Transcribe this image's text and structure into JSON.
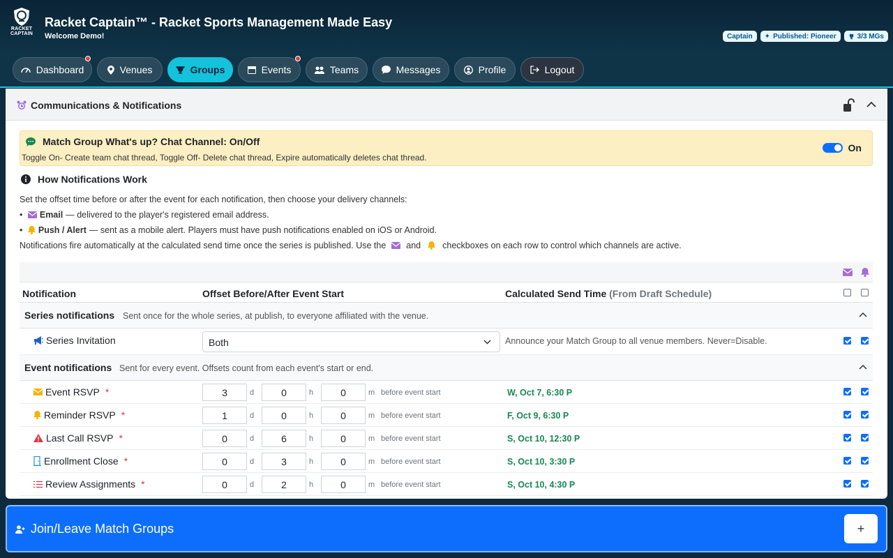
{
  "header": {
    "logo_text_1": "RACKET",
    "logo_text_2": "CAPTAIN",
    "title": "Racket Captain™ - Racket Sports Management Made Easy",
    "welcome": "Welcome Demo!",
    "badges": {
      "role": "Captain",
      "published": "Published: Pioneer",
      "mgs": "3/3 MGs"
    }
  },
  "nav": {
    "dashboard": "Dashboard",
    "venues": "Venues",
    "groups": "Groups",
    "events": "Events",
    "teams": "Teams",
    "messages": "Messages",
    "profile": "Profile",
    "logout": "Logout",
    "active": "Groups"
  },
  "card": {
    "title": "Communications & Notifications",
    "chat": {
      "title": "Match Group What's up? Chat Channel: On/Off",
      "desc": "Toggle On- Create team chat thread, Toggle Off- Delete chat thread, Expire automatically deletes chat thread.",
      "toggle_label": "On",
      "toggle_on": true
    },
    "how": {
      "title": "How Notifications Work",
      "intro": "Set the offset time before or after the event for each notification, then choose your delivery channels:",
      "email_label": "Email",
      "email_desc": "— delivered to the player's registered email address.",
      "push_label": "Push / Alert",
      "push_desc": "— sent as a mobile alert. Players must have push notifications enabled on iOS or Android.",
      "fire_1": "Notifications fire automatically at the calculated send time once the series is published. Use the",
      "fire_2": "and",
      "fire_3": "checkboxes on each row to control which channels are active."
    },
    "table": {
      "col_notification": "Notification",
      "col_offset": "Offset Before/After Event Start",
      "col_send": "Calculated Send Time",
      "col_send_sub": "(From Draft Schedule)",
      "series": {
        "title": "Series notifications",
        "desc": "Sent once for the whole series, at publish, to everyone affiliated with the venue.",
        "invitation": {
          "name": "Series Invitation",
          "select_value": "Both",
          "note": "Announce your Match Group to all venue members. Never=Disable."
        }
      },
      "event": {
        "title": "Event notifications",
        "desc": "Sent for every event. Offsets count from each event's start or end.",
        "unit_d": "d",
        "unit_h": "h",
        "unit_m": "m",
        "suffix": "before event start",
        "rows": [
          {
            "name": "Event RSVP",
            "icon": "envelope-icon",
            "d": "3",
            "h": "0",
            "m": "0",
            "send": "W, Oct 7, 6:30 P"
          },
          {
            "name": "Reminder RSVP",
            "icon": "bell-icon",
            "d": "1",
            "h": "0",
            "m": "0",
            "send": "F, Oct 9, 6:30 P"
          },
          {
            "name": "Last Call RSVP",
            "icon": "warning-icon",
            "d": "0",
            "h": "6",
            "m": "0",
            "send": "S, Oct 10, 12:30 P"
          },
          {
            "name": "Enrollment Close",
            "icon": "door-icon",
            "d": "0",
            "h": "3",
            "m": "0",
            "send": "S, Oct 10, 3:30 P"
          },
          {
            "name": "Review Assignments",
            "icon": "list-icon",
            "d": "0",
            "h": "2",
            "m": "0",
            "send": "S, Oct 10, 4:30 P"
          }
        ]
      }
    }
  },
  "join": {
    "title": "Join/Leave Match Groups",
    "plus": "+"
  },
  "colors": {
    "accent": "#14c3db",
    "primary": "#0d6efd",
    "success": "#198754",
    "header_bg": "#0f3347"
  }
}
